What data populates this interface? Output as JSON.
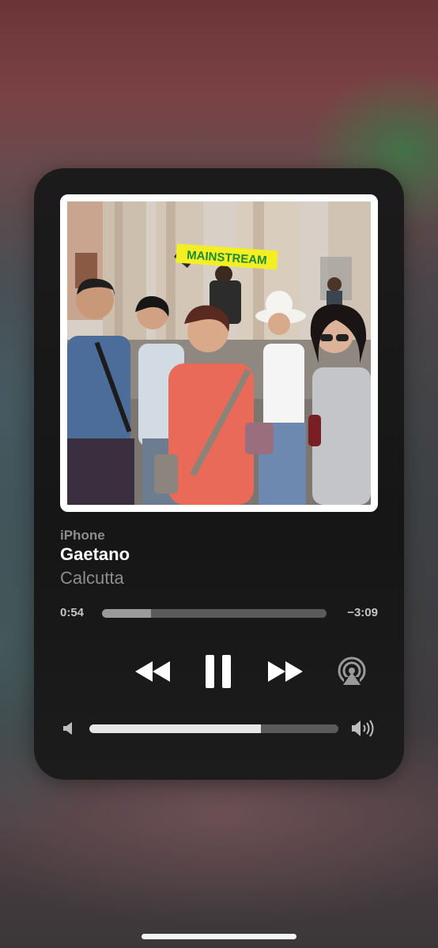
{
  "now_playing": {
    "device": "iPhone",
    "title": "Gaetano",
    "artist": "Calcutta",
    "artwork_banner_text": "MAINSTREAM"
  },
  "playback": {
    "elapsed": "0:54",
    "remaining": "−3:09",
    "progress_fraction": 0.22,
    "state": "playing"
  },
  "volume": {
    "level_fraction": 0.69
  },
  "icons": {
    "rewind": "rewind-icon",
    "pause": "pause-icon",
    "forward": "fast-forward-icon",
    "airplay": "airplay-icon",
    "volume_low": "speaker-low-icon",
    "volume_high": "speaker-high-icon"
  },
  "colors": {
    "accent": "#ffffff",
    "track": "#5a5a5a",
    "scrubber_fill": "#9a9a9a",
    "volume_fill": "#e6e6e6",
    "banner_yellow": "#f4ef22",
    "banner_green": "#1b8a3a"
  }
}
